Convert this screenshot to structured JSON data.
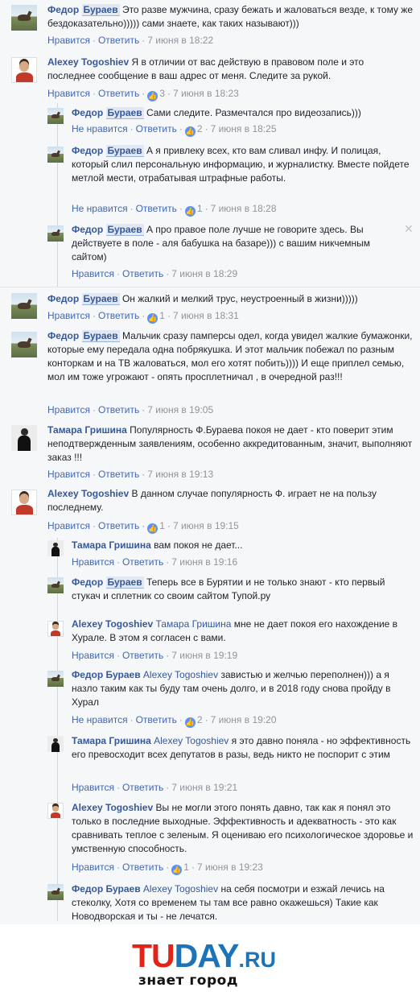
{
  "comments": [
    {
      "author": "Федор Бураев",
      "text": "Это разве мужчина, сразу бежать и жаловаться везде, к тому же бездоказательно))))) сами знаете, как таких называют)))",
      "like": "Нравится",
      "reply": "Ответить",
      "likes": "",
      "time": "7 июня в 18:22",
      "avatar": "horse-avatar"
    },
    {
      "author": "Alexey Togoshiev",
      "text": "Я в отличии от вас действую в правовом поле и это последнее сообщение в ваш адрес от меня. Следите за рукой.",
      "like": "Нравится",
      "reply": "Ответить",
      "likes": "3",
      "time": "7 июня в 18:23",
      "avatar": "man-avatar"
    },
    {
      "author": "Федор Бураев",
      "text": "Сами следите. Размечтался про видеозапись)))",
      "like": "Не нравится",
      "reply": "Ответить",
      "likes": "2",
      "time": "7 июня в 18:25",
      "avatar": "horse-avatar"
    },
    {
      "author": "Федор Бураев",
      "text": "А я привлеку всех, кто вам сливал инфу. И полицая, который слил персональную информацию, и журналистку. Вместе пойдете метлой мести, отрабатывая штрафные работы.",
      "like": "Не нравится",
      "reply": "Ответить",
      "likes": "1",
      "time": "7 июня в 18:28",
      "avatar": "horse-avatar"
    },
    {
      "author": "Федор Бураев",
      "text": "А про правое поле лучше не говорите здесь. Вы действуете в поле - аля бабушка на базаре))) с вашим никчемным сайтом)",
      "like": "Нравится",
      "reply": "Ответить",
      "likes": "",
      "time": "7 июня в 18:29",
      "avatar": "horse-avatar",
      "close": "✕"
    },
    {
      "author": "Федор Бураев",
      "text": "Он жалкий и мелкий трус, неустроенный в жизни)))))",
      "like": "Нравится",
      "reply": "Ответить",
      "likes": "1",
      "time": "7 июня в 18:31",
      "avatar": "horse-avatar"
    },
    {
      "author": "Федор Бураев",
      "text": "Мальчик сразу памперсы одел, когда увидел жалкие бумажонки, которые ему передала одна побрякушка. И этот мальчик побежал по разным конторкам и на ТВ жаловаться, мол его хотят побить)))) И еще приплел семью, мол им тоже угрожают - опять просплетничал , в очередной раз!!!",
      "like": "Нравится",
      "reply": "Ответить",
      "likes": "",
      "time": "7 июня в 19:05",
      "avatar": "horse-avatar"
    },
    {
      "author": "Тамара Гришина",
      "text": "Популярность Ф.Бураева покоя не дает - кто поверит этим неподтвержденным заявлениям, особенно аккредитованным, значит, выполняют заказ !!!",
      "like": "Нравится",
      "reply": "Ответить",
      "likes": "",
      "time": "7 июня в 19:13",
      "avatar": "woman-avatar"
    },
    {
      "author": "Alexey Togoshiev",
      "text": "В данном случае популярность Ф. играет не на пользу последнему.",
      "like": "Нравится",
      "reply": "Ответить",
      "likes": "1",
      "time": "7 июня в 19:15",
      "avatar": "man-avatar"
    },
    {
      "author": "Тамара Гришина",
      "text": "вам покоя не дает...",
      "like": "Нравится",
      "reply": "Ответить",
      "likes": "",
      "time": "7 июня в 19:16",
      "avatar": "woman-avatar"
    },
    {
      "author": "Федор Бураев",
      "text": "Теперь все в Бурятии и не только знают - кто первый стукач и сплетник со своим сайтом Тупой.ру",
      "like": "",
      "reply": "",
      "likes": "",
      "time": "",
      "avatar": "horse-avatar"
    },
    {
      "author": "Alexey Togoshiev",
      "mention": "Тамара Гришина",
      "text": "мне не дает покоя его нахождение в Хурале. В этом я согласен с вами.",
      "like": "Нравится",
      "reply": "Ответить",
      "likes": "",
      "time": "7 июня в 19:19",
      "avatar": "man-avatar"
    },
    {
      "author": "Федор Бураев",
      "mention": "Alexey Togoshiev",
      "text": "завистью и желчью переполнен))) а я назло таким как ты буду там очень долго, и в 2018 году снова пройду в Хурал",
      "like": "Не нравится",
      "reply": "Ответить",
      "likes": "2",
      "time": "7 июня в 19:20",
      "avatar": "horse-avatar"
    },
    {
      "author": "Тамара Гришина",
      "mention": "Alexey Togoshiev",
      "text": "я это давно поняла - но эффективность его превосходит всех депутатов в разы, ведь никто не поспорит с этим",
      "like": "Нравится",
      "reply": "Ответить",
      "likes": "",
      "time": "7 июня в 19:21",
      "avatar": "woman-avatar"
    },
    {
      "author": "Alexey Togoshiev",
      "text": "Вы не могли этого понять давно, так как я понял это только в последние выходные. Эффективность и адекватность - это как сравнивать теплое с зеленым. Я оцениваю его психологическое здоровье и умственную способность.",
      "like": "Нравится",
      "reply": "Ответить",
      "likes": "1",
      "time": "7 июня в 19:23",
      "avatar": "man-avatar"
    },
    {
      "author": "Федор Бураев",
      "mention": "Alexey Togoshiev",
      "text": "на себя посмотри и езжай лечись на стеколку, Хотя со временем ты там все равно окажешься) Такие как Новодворская и ты - не лечатся.",
      "like": "",
      "reply": "",
      "likes": "",
      "time": "",
      "avatar": "horse-avatar"
    }
  ],
  "names": {
    "fedor_first": "Федор",
    "fedor_last": "Бураев"
  },
  "icons": {
    "like": "thumbs-up-icon",
    "close": "close-icon"
  },
  "colors": {
    "link": "#365899",
    "action": "#4267b2",
    "meta": "#90949c",
    "like_badge": "#5890ff",
    "logo_red": "#e2231a",
    "logo_blue": "#1d73b8"
  },
  "footer": {
    "logo_tu": "TU",
    "logo_day": "DAY",
    "logo_ru": ".RU",
    "tagline": "знает город"
  }
}
